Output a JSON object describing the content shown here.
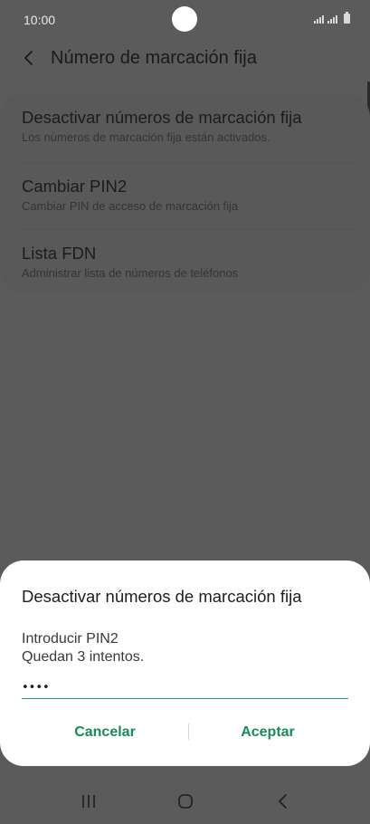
{
  "status_bar": {
    "time": "10:00"
  },
  "header": {
    "title": "Número de marcación fija"
  },
  "settings": {
    "items": [
      {
        "title": "Desactivar números de marcación fija",
        "subtitle": "Los números de marcación fija están activados."
      },
      {
        "title": "Cambiar PIN2",
        "subtitle": "Cambiar PIN de acceso de marcación fija"
      },
      {
        "title": "Lista FDN",
        "subtitle": "Administrar lista de números de teléfonos"
      }
    ]
  },
  "dialog": {
    "title": "Desactivar números de marcación fija",
    "label": "Introducir PIN2",
    "attempts": "Quedan 3 intentos.",
    "pin_value": "••••",
    "cancel_label": "Cancelar",
    "accept_label": "Aceptar"
  },
  "colors": {
    "accent": "#1a8a5a",
    "scrim": "#5b5b5b",
    "dialog_bg": "#ffffff"
  },
  "icons": {
    "back": "chevron-left-icon",
    "recents": "recents-icon",
    "home": "home-icon",
    "nav_back": "nav-back-icon"
  }
}
